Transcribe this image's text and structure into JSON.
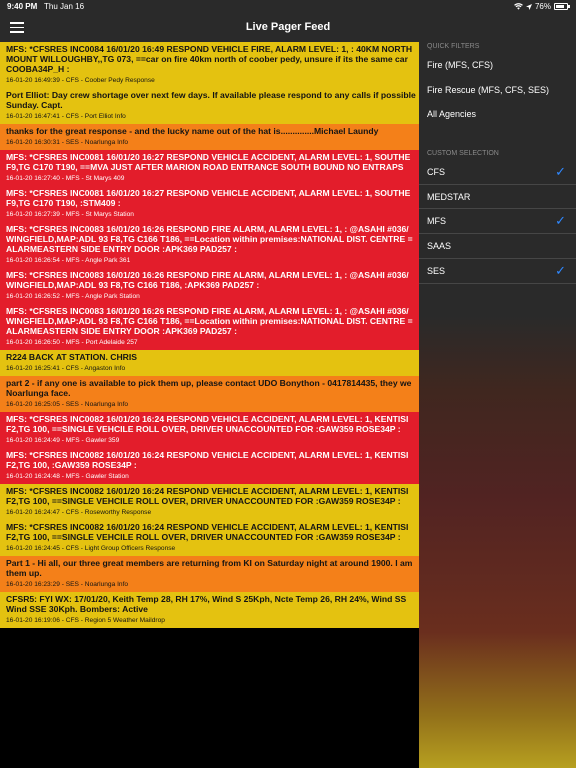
{
  "status_bar": {
    "time": "9:40 PM",
    "date": "Thu Jan 16",
    "battery": "76%"
  },
  "nav": {
    "title": "Live Pager Feed"
  },
  "feed": [
    {
      "color": "yellow",
      "lines": [
        "MFS: *CFSRES INC0084 16/01/20 16:49 RESPOND VEHICLE FIRE, ALARM LEVEL: 1, : 40KM NORTH",
        "MOUNT WILLOUGHBY,,TG 073, ==car on fire 40km north of coober pedy, unsure if its the same car",
        "COOBA34P_H :"
      ],
      "meta": "16-01-20 16:49:39 - CFS - Coober Pedy Response"
    },
    {
      "color": "yellow",
      "lines": [
        "Port Elliot: Day crew shortage over next few days. If available please respond to any calls if possible",
        "Sunday. Capt."
      ],
      "meta": "16-01-20 16:47:41 - CFS - Port Elliot Info"
    },
    {
      "color": "orange",
      "lines": [
        "thanks for the great response - and the lucky name out of the hat is..............Michael Laundy"
      ],
      "meta": "16-01-20 16:30:31 - SES - Noarlunga Info"
    },
    {
      "color": "red",
      "lines": [
        "MFS: *CFSRES INC0081 16/01/20 16:27 RESPOND VEHICLE ACCIDENT, ALARM LEVEL: 1, SOUTHE",
        "F9,TG C170 T190, ==MVA JUST AFTER MARION ROAD ENTRANCE SOUTH BOUND NO ENTRAPS"
      ],
      "meta": "16-01-20 16:27:40 - MFS - St Marys 409"
    },
    {
      "color": "red",
      "lines": [
        "MFS: *CFSRES INC0081 16/01/20 16:27 RESPOND VEHICLE ACCIDENT, ALARM LEVEL: 1, SOUTHE",
        "F9,TG C170 T190, :STM409 :"
      ],
      "meta": "16-01-20 16:27:39 - MFS - St Marys Station"
    },
    {
      "color": "red",
      "lines": [
        "MFS: *CFSRES INC0083 16/01/20 16:26 RESPOND FIRE ALARM, ALARM LEVEL: 1, : @ASAHI #036/",
        "WINGFIELD,MAP:ADL 93 F8,TG C166 T186, ==Location within premises:NATIONAL DIST. CENTRE =",
        "ALARMEASTERN SIDE ENTRY DOOR :APK369 PAD257 :"
      ],
      "meta": "16-01-20 16:26:54 - MFS - Angle Park 361"
    },
    {
      "color": "red",
      "lines": [
        "MFS: *CFSRES INC0083 16/01/20 16:26 RESPOND FIRE ALARM, ALARM LEVEL: 1, : @ASAHI #036/",
        "WINGFIELD,MAP:ADL 93 F8,TG C166 T186, :APK369 PAD257 :"
      ],
      "meta": "16-01-20 16:26:52 - MFS - Angle Park Station"
    },
    {
      "color": "red",
      "lines": [
        "MFS: *CFSRES INC0083 16/01/20 16:26 RESPOND FIRE ALARM, ALARM LEVEL: 1, : @ASAHI #036/",
        "WINGFIELD,MAP:ADL 93 F8,TG C166 T186, ==Location within premises:NATIONAL DIST. CENTRE =",
        "ALARMEASTERN SIDE ENTRY DOOR :APK369 PAD257 :"
      ],
      "meta": "16-01-20 16:26:50 - MFS - Port Adelaide 257"
    },
    {
      "color": "yellow",
      "lines": [
        "R224 BACK AT STATION. CHRIS"
      ],
      "meta": "16-01-20 16:25:41 - CFS - Angaston Info"
    },
    {
      "color": "orange",
      "lines": [
        "part 2 - if any one is available to pick them up, please contact UDO Bonython - 0417814435, they we",
        "Noarlunga face."
      ],
      "meta": "16-01-20 16:25:05 - SES - Noarlunga Info"
    },
    {
      "color": "red",
      "lines": [
        "MFS: *CFSRES INC0082 16/01/20 16:24 RESPOND VEHICLE ACCIDENT, ALARM LEVEL: 1, KENTISI",
        "F2,TG 100, ==SINGLE VEHCILE ROLL OVER, DRIVER UNACCOUNTED FOR :GAW359 ROSE34P :"
      ],
      "meta": "16-01-20 16:24:49 - MFS - Gawler 359"
    },
    {
      "color": "red",
      "lines": [
        "MFS: *CFSRES INC0082 16/01/20 16:24 RESPOND VEHICLE ACCIDENT, ALARM LEVEL: 1, KENTISI",
        "F2,TG 100, :GAW359 ROSE34P :"
      ],
      "meta": "16-01-20 16:24:48 - MFS - Gawler Station"
    },
    {
      "color": "yellow",
      "lines": [
        "MFS: *CFSRES INC0082 16/01/20 16:24 RESPOND VEHICLE ACCIDENT, ALARM LEVEL: 1, KENTISI",
        "F2,TG 100, ==SINGLE VEHCILE ROLL OVER, DRIVER UNACCOUNTED FOR :GAW359 ROSE34P :"
      ],
      "meta": "16-01-20 16:24:47 - CFS - Roseworthy Response"
    },
    {
      "color": "yellow",
      "lines": [
        "MFS: *CFSRES INC0082 16/01/20 16:24 RESPOND VEHICLE ACCIDENT, ALARM LEVEL: 1, KENTISI",
        "F2,TG 100, ==SINGLE VEHCILE ROLL OVER, DRIVER UNACCOUNTED FOR :GAW359 ROSE34P :"
      ],
      "meta": "16-01-20 16:24:45 - CFS - Light Group Officers Response"
    },
    {
      "color": "orange",
      "lines": [
        "Part 1 - Hi all, our three great members are returning from KI on Saturday night at around 1900. I am",
        "them up."
      ],
      "meta": "16-01-20 16:23:29 - SES - Noarlunga Info"
    },
    {
      "color": "yellow",
      "lines": [
        "CFSR5: FYI WX: 17/01/20, Keith Temp 28, RH 17%, Wind S 25Kph, Ncte Temp 26, RH 24%, Wind SS",
        "Wind SSE 30Kph. Bombers: Active"
      ],
      "meta": "16-01-20 16:19:06 - CFS - Region 5 Weather Maildrop"
    }
  ],
  "drawer": {
    "quick_filters_label": "QUICK FILTERS",
    "quick_filters": [
      "Fire (MFS, CFS)",
      "Fire Rescue (MFS, CFS, SES)",
      "All Agencies"
    ],
    "custom_label": "CUSTOM SELECTION",
    "custom": [
      {
        "label": "CFS",
        "checked": true
      },
      {
        "label": "MEDSTAR",
        "checked": false
      },
      {
        "label": "MFS",
        "checked": true
      },
      {
        "label": "SAAS",
        "checked": false
      },
      {
        "label": "SES",
        "checked": true
      }
    ],
    "check_color": "#2f88ff"
  }
}
